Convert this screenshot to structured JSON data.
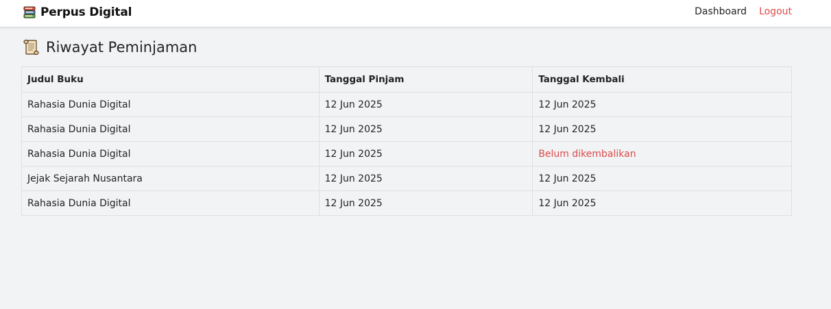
{
  "navbar": {
    "brand_title": "Perpus Digital",
    "brand_icon": "books-icon",
    "links": {
      "dashboard": "Dashboard",
      "logout": "Logout"
    },
    "colors": {
      "logout": "#dc4a4a"
    }
  },
  "page": {
    "title": "Riwayat Peminjaman",
    "title_icon": "scroll-icon"
  },
  "table": {
    "headers": [
      "Judul Buku",
      "Tanggal Pinjam",
      "Tanggal Kembali"
    ],
    "rows": [
      {
        "judul": "Rahasia Dunia Digital",
        "pinjam": "12 Jun 2025",
        "kembali": "12 Jun 2025",
        "returned": true
      },
      {
        "judul": "Rahasia Dunia Digital",
        "pinjam": "12 Jun 2025",
        "kembali": "12 Jun 2025",
        "returned": true
      },
      {
        "judul": "Rahasia Dunia Digital",
        "pinjam": "12 Jun 2025",
        "kembali": "Belum dikembalikan",
        "returned": false
      },
      {
        "judul": "Jejak Sejarah Nusantara",
        "pinjam": "12 Jun 2025",
        "kembali": "12 Jun 2025",
        "returned": true
      },
      {
        "judul": "Rahasia Dunia Digital",
        "pinjam": "12 Jun 2025",
        "kembali": "12 Jun 2025",
        "returned": true
      }
    ],
    "colors": {
      "not_returned": "#dc4a4a"
    }
  }
}
